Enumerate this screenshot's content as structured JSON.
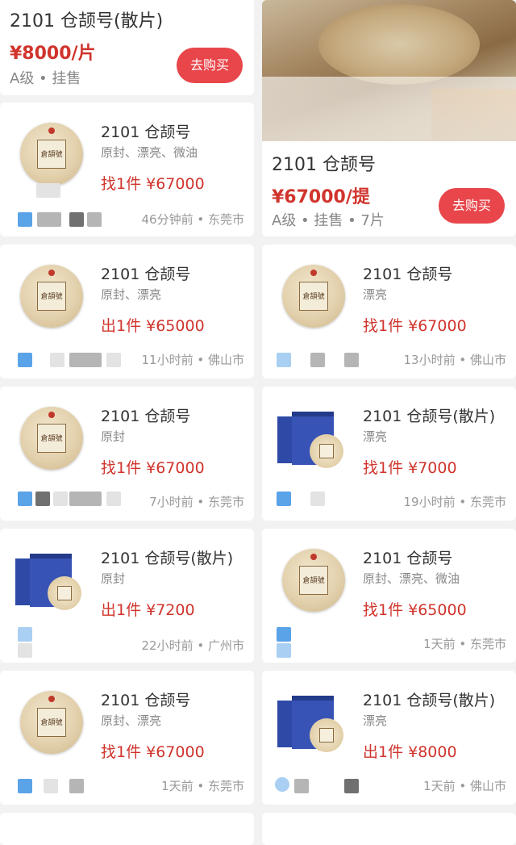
{
  "top_left": {
    "title": "2101 仓颉号(散片)",
    "price": "¥8000/片",
    "meta": "A级 • 挂售",
    "buy_label": "去购买"
  },
  "top_right": {
    "title": "2101 仓颉号",
    "price": "¥67000/提",
    "meta": "A级 • 挂售 • 7片",
    "buy_label": "去购买"
  },
  "cake_label": "倉頡號",
  "items": [
    {
      "title": "2101 仓颉号",
      "desc": "原封、漂亮、微油",
      "price": "找1件 ¥67000",
      "meta": "46分钟前 • 东莞市"
    },
    {
      "title": "2101 仓颉号",
      "desc": "原封、漂亮",
      "price": "出1件 ¥65000",
      "meta": "11小时前 • 佛山市"
    },
    {
      "title": "2101 仓颉号",
      "desc": "漂亮",
      "price": "找1件 ¥67000",
      "meta": "13小时前 • 佛山市"
    },
    {
      "title": "2101 仓颉号",
      "desc": "原封",
      "price": "找1件 ¥67000",
      "meta": "7小时前 • 东莞市"
    },
    {
      "title": "2101 仓颉号(散片)",
      "desc": "漂亮",
      "price": "找1件 ¥7000",
      "meta": "19小时前 • 东莞市"
    },
    {
      "title": "2101 仓颉号(散片)",
      "desc": "原封",
      "price": "出1件 ¥7200",
      "meta": "22小时前 • 广州市"
    },
    {
      "title": "2101 仓颉号",
      "desc": "原封、漂亮、微油",
      "price": "找1件 ¥65000",
      "meta": "1天前 • 东莞市"
    },
    {
      "title": "2101 仓颉号",
      "desc": "原封、漂亮",
      "price": "找1件 ¥67000",
      "meta": "1天前 • 东莞市"
    },
    {
      "title": "2101 仓颉号(散片)",
      "desc": "漂亮",
      "price": "出1件 ¥8000",
      "meta": "1天前 • 佛山市"
    }
  ],
  "colors": {
    "price_red": "#d0342c",
    "button_red": "#e8464b",
    "background": "#f2f2f2"
  }
}
